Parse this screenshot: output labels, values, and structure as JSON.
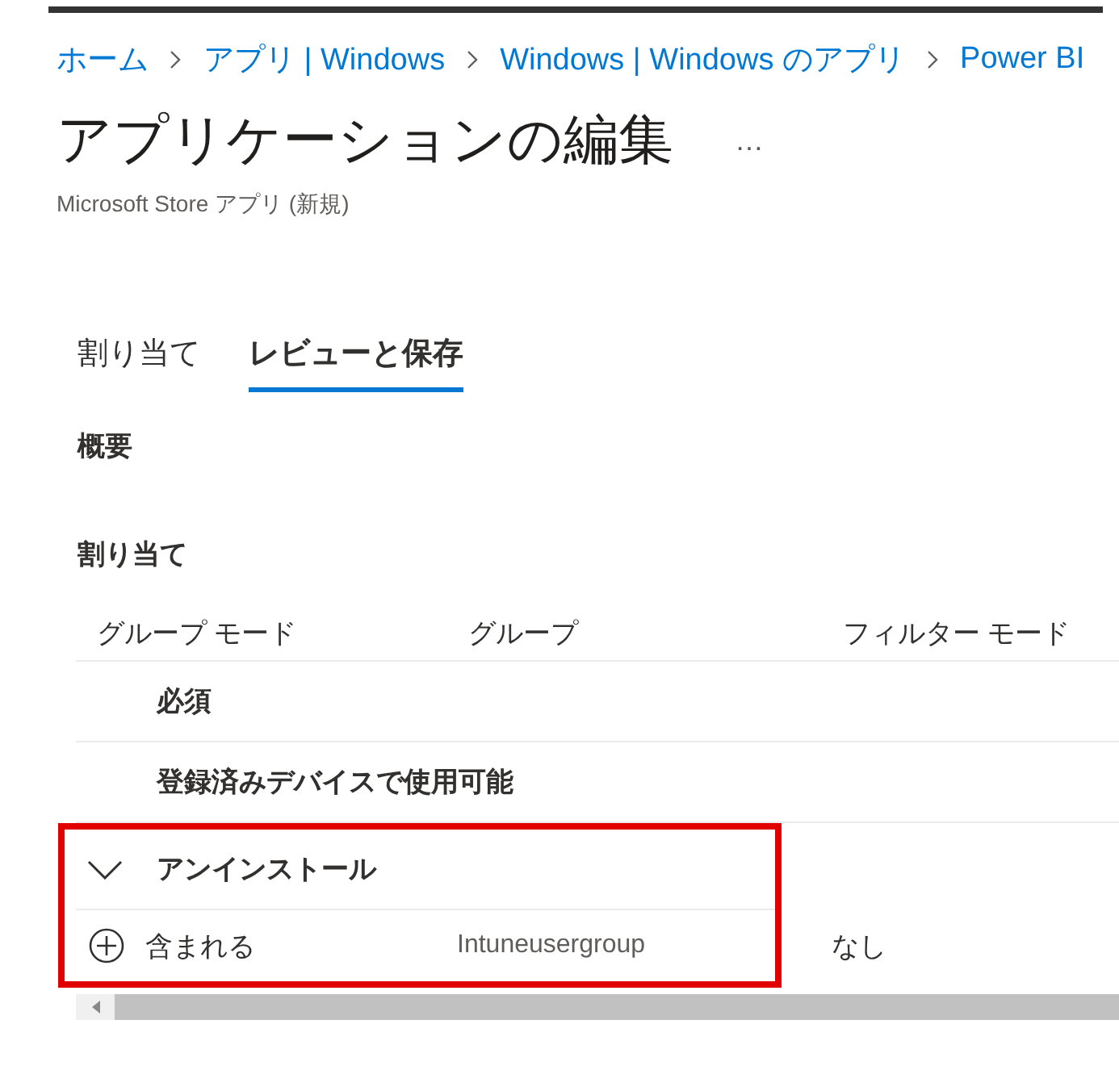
{
  "breadcrumb": [
    "ホーム",
    "アプリ | Windows",
    "Windows | Windows のアプリ",
    "Power BI"
  ],
  "title": "アプリケーションの編集",
  "more": "…",
  "subtitle": "Microsoft Store アプリ (新規)",
  "tabs": [
    {
      "label": "割り当て",
      "selected": false
    },
    {
      "label": "レビューと保存",
      "selected": true
    }
  ],
  "summary_heading": "概要",
  "assignments_heading": "割り当て",
  "table": {
    "columns": [
      "グループ モード",
      "グループ",
      "フィルター モード"
    ],
    "groups": [
      {
        "label": "必須",
        "expanded": false,
        "highlighted": false
      },
      {
        "label": "登録済みデバイスで使用可能",
        "expanded": false,
        "highlighted": false
      },
      {
        "label": "アンインストール",
        "expanded": true,
        "highlighted": true,
        "rows": [
          {
            "mode": "含まれる",
            "group": "Intuneusergroup",
            "filter_mode": "なし"
          }
        ]
      }
    ]
  }
}
